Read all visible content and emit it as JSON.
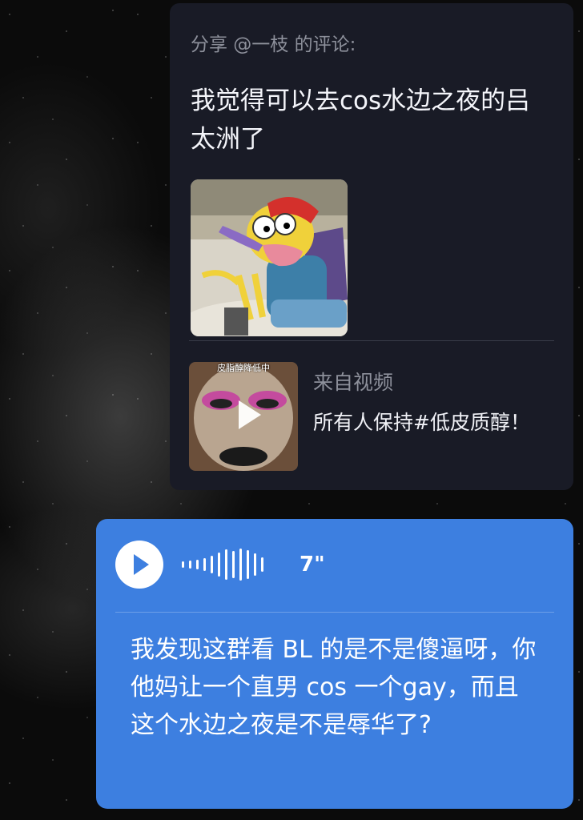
{
  "shared_comment": {
    "header": "分享 @一枝 的评论:",
    "comment_text": "我觉得可以去cos水边之夜的吕太洲了",
    "image": "cartoon-fish-character-sticker",
    "video": {
      "source_label": "来自视频",
      "title": "所有人保持#低皮质醇！",
      "thumbnail_caption": "皮脂醇降低中",
      "icon": "play-icon"
    }
  },
  "voice_message": {
    "icon": "play-icon",
    "duration": "7\"",
    "transcript": "我发现这群看 BL 的是不是傻逼呀，你他妈让一个直男 cos 一个gay，而且这个水边之夜是不是辱华了?",
    "colors": {
      "bubble": "#3d7fe0"
    }
  }
}
